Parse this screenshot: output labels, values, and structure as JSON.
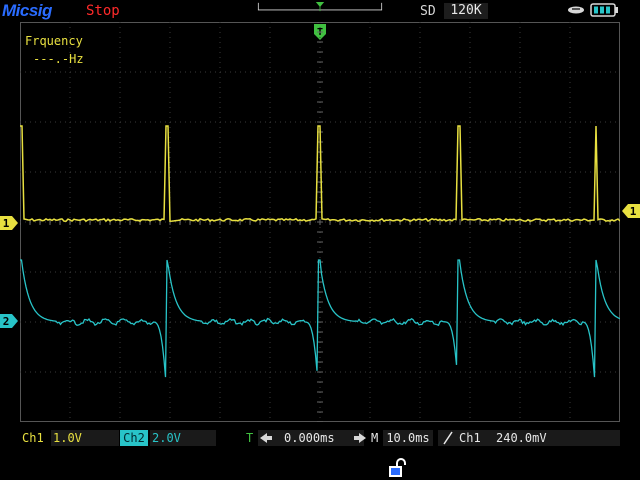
{
  "header": {
    "brand": "Micsig",
    "status": "Stop",
    "sd_label": "SD",
    "sd_value": "120K"
  },
  "measurement": {
    "label": "Frquency",
    "value": "---.-Hz"
  },
  "markers": {
    "ch1": "1",
    "ch2": "2",
    "trigger_level": "1"
  },
  "footer": {
    "ch1_name": "Ch1",
    "ch1_scale": "1.0V",
    "ch2_name": "Ch2",
    "ch2_scale": "2.0V",
    "time_label": "T",
    "time_offset": "0.000ms",
    "timebase_label": "M",
    "timebase": "10.0ms",
    "trigger_source": "Ch1",
    "trigger_level": "240.0mV"
  },
  "colors": {
    "ch1": "#e8e040",
    "ch2": "#28c4c8",
    "brand": "#2a6cff",
    "status": "#ff2a2a",
    "trigger": "#40c040"
  },
  "icons": {
    "usb": "usb-icon",
    "battery": "battery-icon",
    "lock": "lock-icon",
    "trigger_edge": "rising-edge-icon"
  }
}
